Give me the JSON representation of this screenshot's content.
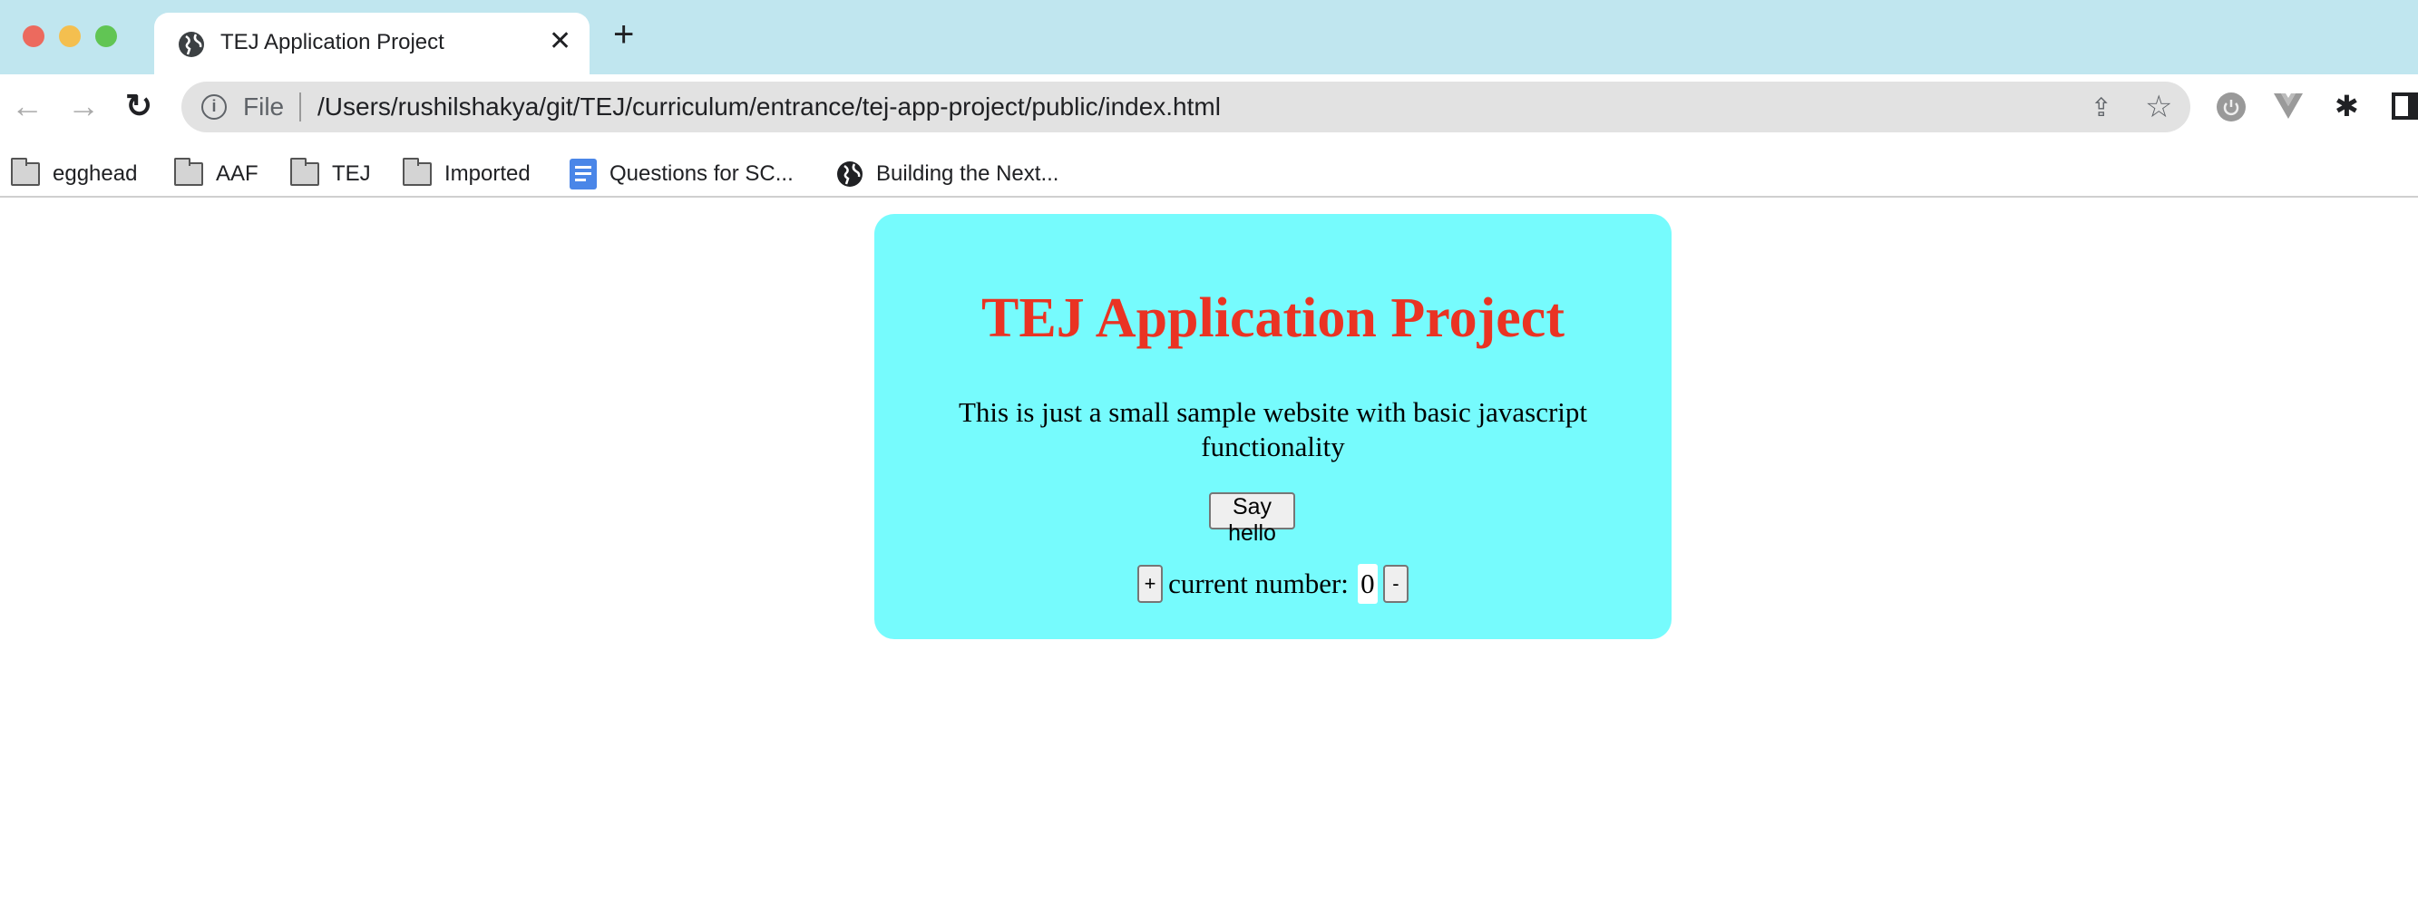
{
  "browser": {
    "tab_title": "TEJ Application Project",
    "url_scheme_label": "File",
    "url": "/Users/rushilshakya/git/TEJ/curriculum/entrance/tej-app-project/public/index.html",
    "bookmarks": [
      "egghead",
      "AAF",
      "TEJ",
      "Imported",
      "Questions for SC...",
      "Building the Next..."
    ]
  },
  "page": {
    "heading": "TEJ Application Project",
    "description": "This is just a small sample website with basic javascript functionality",
    "say_hello_label": "Say hello",
    "plus_label": "+",
    "counter_label": "current number:",
    "counter_value": "0",
    "minus_label": "-"
  },
  "colors": {
    "tabbar": "#c0e6ef",
    "card": "#76fbfd",
    "heading": "#ea3323"
  }
}
